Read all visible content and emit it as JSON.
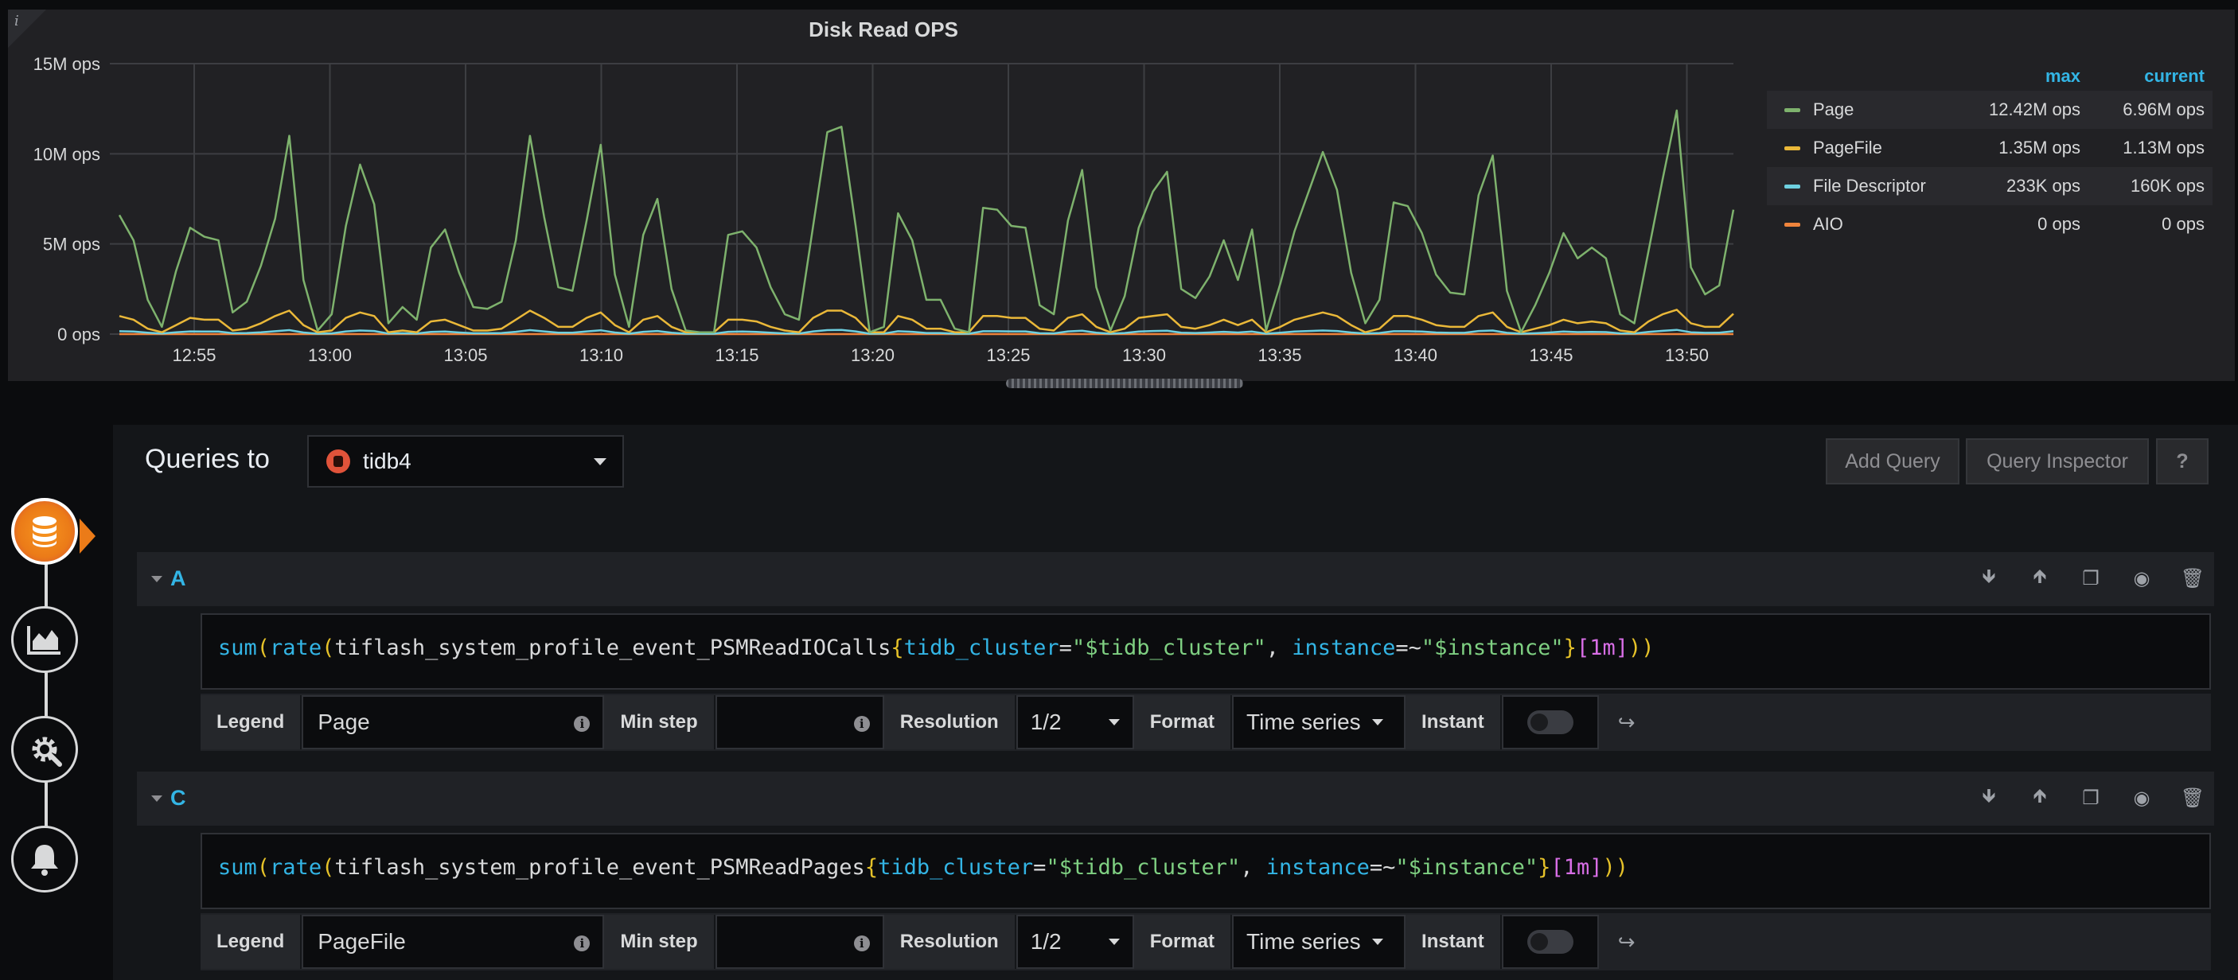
{
  "panel": {
    "title": "Disk Read OPS",
    "info_icon": "i"
  },
  "legend": {
    "col_max": "max",
    "col_current": "current",
    "rows": [
      {
        "name": "Page",
        "max": "12.42M ops",
        "current": "6.96M ops",
        "color": "#7eb26d"
      },
      {
        "name": "PageFile",
        "max": "1.35M ops",
        "current": "1.13M ops",
        "color": "#eab839"
      },
      {
        "name": "File Descriptor",
        "max": "233K ops",
        "current": "160K ops",
        "color": "#6ed0e0"
      },
      {
        "name": "AIO",
        "max": "0 ops",
        "current": "0 ops",
        "color": "#ef843c"
      }
    ]
  },
  "chart_data": {
    "type": "line",
    "title": "Disk Read OPS",
    "y_ticks": [
      "15M ops",
      "10M ops",
      "5M ops",
      "0 ops"
    ],
    "x_ticks": [
      "12:55",
      "13:00",
      "13:05",
      "13:10",
      "13:15",
      "13:20",
      "13:25",
      "13:30",
      "13:35",
      "13:40",
      "13:45",
      "13:50"
    ],
    "ylim": [
      0,
      15
    ],
    "y_unit": "M ops",
    "grid": true,
    "legend_position": "right",
    "series": [
      {
        "name": "Page",
        "color": "#7eb26d",
        "values": [
          6.6,
          5.2,
          1.9,
          0.4,
          3.5,
          5.9,
          5.4,
          5.2,
          1.2,
          1.8,
          3.8,
          6.4,
          11.0,
          3.0,
          0.2,
          1.1,
          6.0,
          9.4,
          7.2,
          0.6,
          1.5,
          0.8,
          4.8,
          5.8,
          3.4,
          1.5,
          1.4,
          1.8,
          5.2,
          11.0,
          6.5,
          2.6,
          2.4,
          6.3,
          10.5,
          3.3,
          0.4,
          5.5,
          7.5,
          2.5,
          0.2,
          0.1,
          0.1,
          5.5,
          5.7,
          4.8,
          2.6,
          1.1,
          0.8,
          6.0,
          11.2,
          11.5,
          6.0,
          0.1,
          0.4,
          6.7,
          5.2,
          1.9,
          1.9,
          0.3,
          0.1,
          7.0,
          6.9,
          6.0,
          5.9,
          1.6,
          1.1,
          6.3,
          9.1,
          2.6,
          0.2,
          2.1,
          5.9,
          7.9,
          9.0,
          2.5,
          2.0,
          3.2,
          5.2,
          3.0,
          5.8,
          0.2,
          2.8,
          5.7,
          7.9,
          10.1,
          8.0,
          3.4,
          0.6,
          1.9,
          7.3,
          7.1,
          5.6,
          3.3,
          2.3,
          2.2,
          7.7,
          9.9,
          2.4,
          0.1,
          1.6,
          3.4,
          5.6,
          4.2,
          4.8,
          4.2,
          1.1,
          0.6,
          4.6,
          8.6,
          12.4,
          3.7,
          2.2,
          2.7,
          6.9
        ]
      },
      {
        "name": "PageFile",
        "color": "#eab839",
        "values": [
          1.0,
          0.8,
          0.3,
          0.1,
          0.5,
          0.9,
          0.8,
          0.8,
          0.2,
          0.3,
          0.6,
          1.0,
          1.3,
          0.5,
          0.1,
          0.2,
          0.9,
          1.2,
          1.0,
          0.1,
          0.2,
          0.1,
          0.7,
          0.8,
          0.5,
          0.2,
          0.2,
          0.3,
          0.8,
          1.3,
          0.9,
          0.4,
          0.4,
          0.9,
          1.2,
          0.5,
          0.1,
          0.8,
          1.0,
          0.4,
          0.1,
          0.1,
          0.1,
          0.8,
          0.8,
          0.7,
          0.4,
          0.2,
          0.1,
          0.9,
          1.3,
          1.3,
          0.9,
          0.1,
          0.1,
          1.0,
          0.8,
          0.3,
          0.3,
          0.1,
          0.1,
          1.0,
          1.0,
          0.9,
          0.9,
          0.3,
          0.2,
          0.9,
          1.1,
          0.4,
          0.1,
          0.3,
          0.9,
          1.0,
          1.1,
          0.4,
          0.3,
          0.5,
          0.8,
          0.5,
          0.8,
          0.1,
          0.4,
          0.8,
          1.0,
          1.2,
          1.0,
          0.5,
          0.1,
          0.3,
          1.0,
          1.0,
          0.8,
          0.5,
          0.4,
          0.4,
          1.0,
          1.2,
          0.4,
          0.1,
          0.3,
          0.5,
          0.8,
          0.6,
          0.7,
          0.6,
          0.2,
          0.1,
          0.7,
          1.1,
          1.35,
          0.6,
          0.4,
          0.4,
          1.13
        ]
      },
      {
        "name": "File Descriptor",
        "color": "#6ed0e0",
        "values": [
          0.16,
          0.14,
          0.08,
          0.03,
          0.1,
          0.15,
          0.14,
          0.14,
          0.05,
          0.06,
          0.1,
          0.16,
          0.22,
          0.09,
          0.02,
          0.04,
          0.15,
          0.2,
          0.17,
          0.03,
          0.05,
          0.03,
          0.12,
          0.14,
          0.09,
          0.05,
          0.05,
          0.06,
          0.13,
          0.22,
          0.15,
          0.08,
          0.08,
          0.15,
          0.21,
          0.09,
          0.02,
          0.13,
          0.17,
          0.08,
          0.02,
          0.02,
          0.02,
          0.13,
          0.14,
          0.12,
          0.08,
          0.04,
          0.03,
          0.15,
          0.22,
          0.23,
          0.15,
          0.02,
          0.03,
          0.16,
          0.13,
          0.06,
          0.06,
          0.02,
          0.02,
          0.16,
          0.16,
          0.15,
          0.15,
          0.05,
          0.04,
          0.15,
          0.19,
          0.08,
          0.02,
          0.06,
          0.14,
          0.17,
          0.19,
          0.08,
          0.06,
          0.09,
          0.13,
          0.09,
          0.14,
          0.02,
          0.08,
          0.14,
          0.17,
          0.2,
          0.17,
          0.09,
          0.03,
          0.06,
          0.16,
          0.16,
          0.14,
          0.09,
          0.07,
          0.07,
          0.17,
          0.2,
          0.07,
          0.02,
          0.05,
          0.09,
          0.14,
          0.11,
          0.12,
          0.11,
          0.04,
          0.03,
          0.12,
          0.18,
          0.233,
          0.1,
          0.07,
          0.08,
          0.16
        ]
      },
      {
        "name": "AIO",
        "color": "#ef843c",
        "values": [
          0,
          0,
          0,
          0,
          0,
          0,
          0,
          0,
          0,
          0,
          0,
          0,
          0,
          0,
          0,
          0,
          0,
          0,
          0,
          0,
          0,
          0,
          0,
          0,
          0,
          0,
          0,
          0,
          0,
          0,
          0,
          0,
          0,
          0,
          0,
          0,
          0,
          0,
          0,
          0,
          0,
          0,
          0,
          0,
          0,
          0,
          0,
          0,
          0,
          0,
          0,
          0,
          0,
          0,
          0,
          0,
          0,
          0,
          0,
          0,
          0,
          0,
          0,
          0,
          0,
          0,
          0,
          0,
          0,
          0,
          0,
          0,
          0,
          0,
          0,
          0,
          0,
          0,
          0,
          0,
          0,
          0,
          0,
          0,
          0,
          0,
          0,
          0,
          0,
          0,
          0,
          0,
          0,
          0,
          0,
          0,
          0,
          0,
          0,
          0,
          0,
          0,
          0,
          0,
          0,
          0,
          0,
          0,
          0,
          0,
          0,
          0,
          0,
          0,
          0
        ]
      }
    ]
  },
  "editor": {
    "queries_to": "Queries to",
    "datasource": "tidb4",
    "add_query": "Add Query",
    "query_inspector": "Query Inspector",
    "help": "?"
  },
  "queries": [
    {
      "letter": "A",
      "expr": {
        "fn1": "sum",
        "fn2": "rate",
        "metric": "tiflash_system_profile_event_PSMReadIOCalls",
        "label1": "tidb_cluster",
        "val1": "\"$tidb_cluster\"",
        "label2": "instance",
        "op2": "=~",
        "val2": "\"$instance\"",
        "range": "[1m]"
      },
      "legend_label": "Legend",
      "legend_value": "Page",
      "minstep_label": "Min step",
      "minstep_value": "",
      "resolution_label": "Resolution",
      "resolution_value": "1/2",
      "format_label": "Format",
      "format_value": "Time series",
      "instant_label": "Instant"
    },
    {
      "letter": "C",
      "expr": {
        "fn1": "sum",
        "fn2": "rate",
        "metric": "tiflash_system_profile_event_PSMReadPages",
        "label1": "tidb_cluster",
        "val1": "\"$tidb_cluster\"",
        "label2": "instance",
        "op2": "=~",
        "val2": "\"$instance\"",
        "range": "[1m]"
      },
      "legend_label": "Legend",
      "legend_value": "PageFile",
      "minstep_label": "Min step",
      "minstep_value": "",
      "resolution_label": "Resolution",
      "resolution_value": "1/2",
      "format_label": "Format",
      "format_value": "Time series",
      "instant_label": "Instant"
    }
  ],
  "icons": {
    "datasource": "database-icon",
    "visualization": "area-chart-icon",
    "general": "gear-icon",
    "alert": "bell-icon"
  }
}
